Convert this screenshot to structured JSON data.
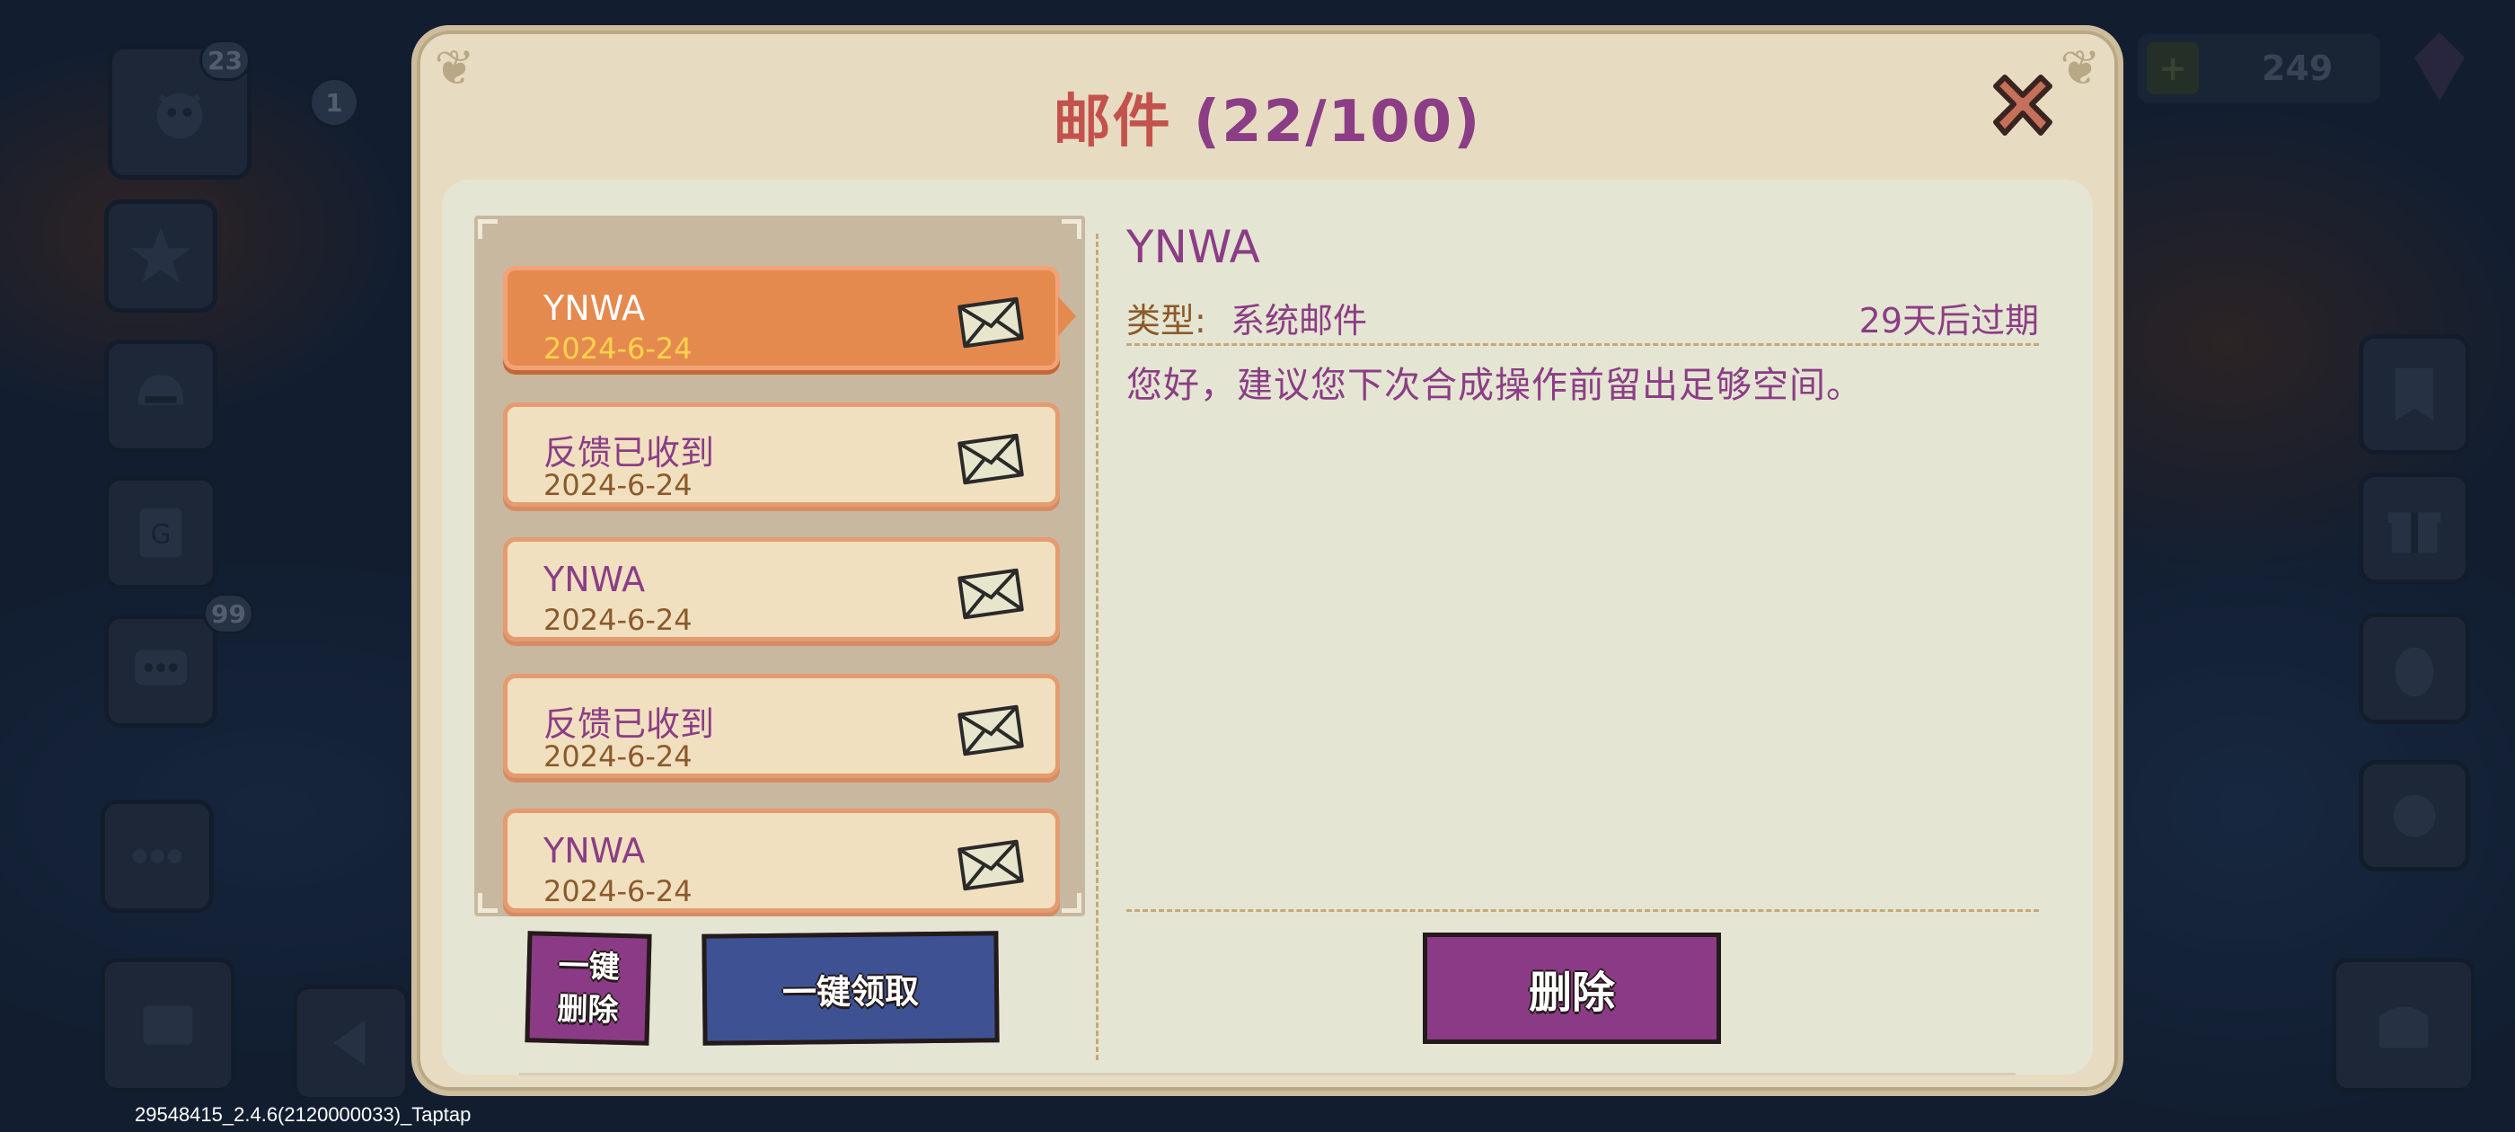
{
  "dialog": {
    "title": "邮件",
    "count": "(22/100)"
  },
  "mails": [
    {
      "title": "YNWA",
      "date": "2024-6-24",
      "selected": true
    },
    {
      "title": "反馈已收到",
      "date": "2024-6-24",
      "selected": false
    },
    {
      "title": "YNWA",
      "date": "2024-6-24",
      "selected": false
    },
    {
      "title": "反馈已收到",
      "date": "2024-6-24",
      "selected": false
    },
    {
      "title": "YNWA",
      "date": "2024-6-24",
      "selected": false
    }
  ],
  "detail": {
    "title": "YNWA",
    "type_label": "类型:",
    "type_value": "系统邮件",
    "expiry": "29天后过期",
    "body": "您好，建议您下次合成操作前留出足够空间。"
  },
  "buttons": {
    "delete_all_line1": "一键",
    "delete_all_line2": "删除",
    "claim_all": "一键领取",
    "delete": "删除"
  },
  "background": {
    "badge_level": "23",
    "badge_count": "1",
    "badge_chat": "99",
    "gem_amount": "249"
  },
  "footer": {
    "version": "29548415_2.4.6(2120000033)_Taptap"
  },
  "colors": {
    "accent_purple": "#8b3d85",
    "title_red": "#c3524c",
    "selected_orange": "#e58a4f",
    "claim_blue": "#3e5293"
  }
}
